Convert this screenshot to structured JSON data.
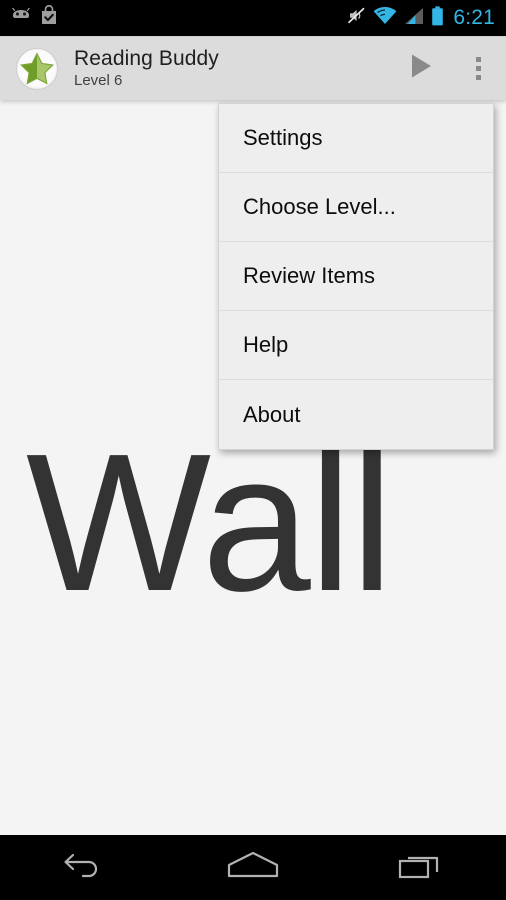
{
  "status_bar": {
    "background": "#000000",
    "clock": "6:21",
    "clock_color": "#33b5e5",
    "left_icons": [
      {
        "name": "android-debug-icon",
        "label": "android-head"
      },
      {
        "name": "play-store-download-complete-icon",
        "label": "bag-check"
      }
    ],
    "right_icons": [
      {
        "name": "silent-mode-icon",
        "label": "muted-speaker"
      },
      {
        "name": "wifi-icon",
        "label": "wifi-signal"
      },
      {
        "name": "cellular-signal-icon",
        "label": "signal-bars"
      },
      {
        "name": "battery-icon",
        "label": "battery-full"
      }
    ]
  },
  "action_bar": {
    "background": "#dcdcdc",
    "app_icon": "star-half-green-icon",
    "title": "Reading Buddy",
    "subtitle": "Level 6",
    "play_label": "play-icon",
    "overflow_label": "overflow-menu-icon"
  },
  "content": {
    "background": "#f4f4f4",
    "word": "Wall",
    "word_color": "#333333"
  },
  "overflow_menu": {
    "background": "#eeeeee",
    "items": [
      {
        "label": "Settings"
      },
      {
        "label": "Choose Level..."
      },
      {
        "label": "Review Items"
      },
      {
        "label": "Help"
      },
      {
        "label": "About"
      }
    ]
  },
  "nav_bar": {
    "background": "#000000",
    "buttons": [
      {
        "name": "back-button",
        "label": "back-icon"
      },
      {
        "name": "home-button",
        "label": "home-icon"
      },
      {
        "name": "recents-button",
        "label": "recents-icon"
      }
    ]
  }
}
